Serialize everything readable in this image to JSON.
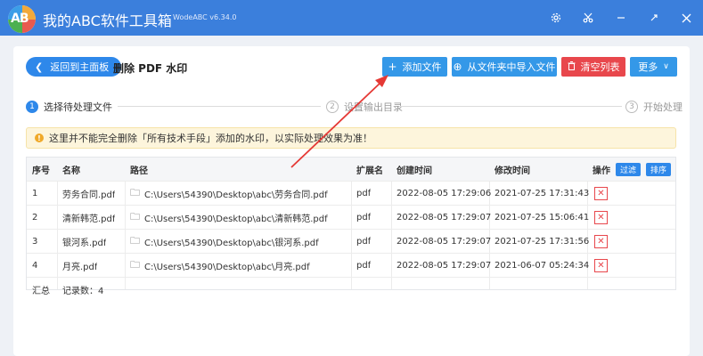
{
  "app": {
    "title": "我的ABC软件工具箱",
    "version": "WodeABC v6.34.0",
    "logo_text": "AB",
    "icons": [
      "settings-icon",
      "scissors-icon",
      "minimize-icon",
      "maximize-icon",
      "close-icon"
    ]
  },
  "toolbar": {
    "back_label": "返回到主面板",
    "page_title": "删除 PDF 水印",
    "add_file_label": "添加文件",
    "import_folder_label": "从文件夹中导入文件",
    "clear_list_label": "清空列表",
    "more_label": "更多"
  },
  "steps": [
    {
      "num": "1",
      "label": "选择待处理文件",
      "active": true
    },
    {
      "num": "2",
      "label": "设置输出目录",
      "active": false
    },
    {
      "num": "3",
      "label": "开始处理",
      "active": false
    }
  ],
  "notice": "这里并不能完全删除「所有技术手段」添加的水印，以实际处理效果为准！",
  "table": {
    "headers": {
      "seq": "序号",
      "name": "名称",
      "path": "路径",
      "ext": "扩展名",
      "created": "创建时间",
      "modified": "修改时间",
      "action": "操作",
      "filter": "过滤",
      "sort": "排序"
    },
    "rows": [
      {
        "seq": "1",
        "name": "劳务合同.pdf",
        "path": "C:\\Users\\54390\\Desktop\\abc\\劳务合同.pdf",
        "ext": "pdf",
        "created": "2022-08-05 17:29:06",
        "modified": "2021-07-25 17:31:43"
      },
      {
        "seq": "2",
        "name": "清新韩范.pdf",
        "path": "C:\\Users\\54390\\Desktop\\abc\\清新韩范.pdf",
        "ext": "pdf",
        "created": "2022-08-05 17:29:07",
        "modified": "2021-07-25 15:06:41"
      },
      {
        "seq": "3",
        "name": "银河系.pdf",
        "path": "C:\\Users\\54390\\Desktop\\abc\\银河系.pdf",
        "ext": "pdf",
        "created": "2022-08-05 17:29:07",
        "modified": "2021-07-25 17:31:56"
      },
      {
        "seq": "4",
        "name": "月亮.pdf",
        "path": "C:\\Users\\54390\\Desktop\\abc\\月亮.pdf",
        "ext": "pdf",
        "created": "2022-08-05 17:29:07",
        "modified": "2021-06-07 05:24:34"
      }
    ],
    "summary_label": "汇总",
    "record_count": "记录数：4"
  },
  "colors": {
    "titlebar": "#3b7fdc",
    "primary": "#3498e8",
    "danger": "#e8474c",
    "notice_bg": "#fdf5dc",
    "annotation_arrow": "#e53935"
  }
}
